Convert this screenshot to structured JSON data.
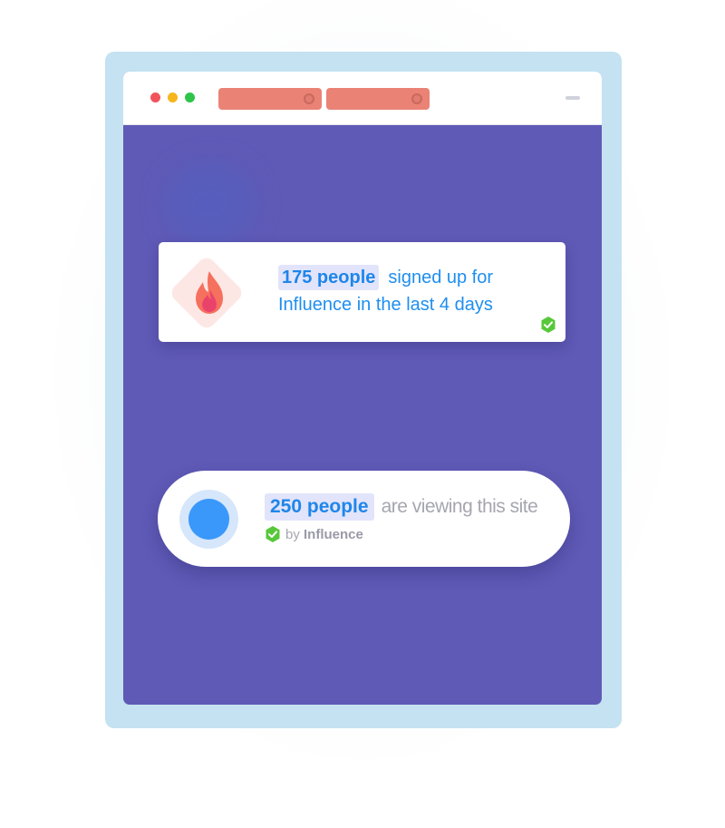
{
  "signup_notification": {
    "count_text": "175 people",
    "message": "signed up for Influence in the last 4 days",
    "icon": "fire-icon",
    "verified_icon": "verified-check-icon"
  },
  "viewing_notification": {
    "count_text": "250 people",
    "message": "are viewing this site",
    "by_prefix": "by",
    "brand": "Influence",
    "icon": "pulse-dot-icon",
    "verified_icon": "verified-check-icon"
  },
  "colors": {
    "page_background": "#5f5ab6",
    "frame": "#c4e2f1",
    "accent_blue": "#1e8ef0",
    "highlight_bg": "#e2e4fb",
    "tab": "#ea8276",
    "verified_green": "#57c83a"
  }
}
